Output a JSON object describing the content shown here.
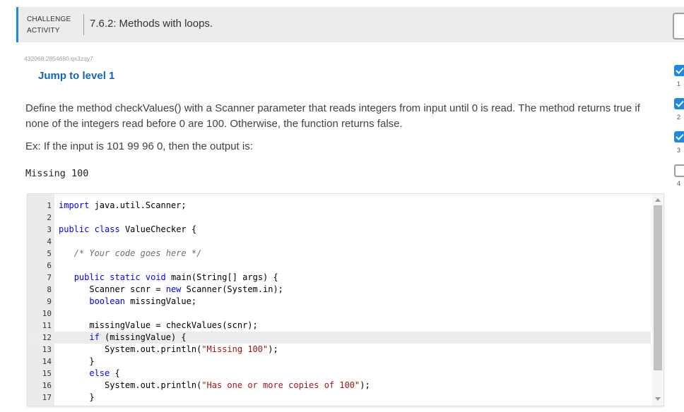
{
  "header": {
    "label_line1": "CHALLENGE",
    "label_line2": "ACTIVITY",
    "title_number": "7.6.2:",
    "title_text": "Methods with loops."
  },
  "activity_code": "432068.2854680.qx3zqy7",
  "jump_link": "Jump to level 1",
  "instructions": {
    "paragraph": "Define the method checkValues() with a Scanner parameter that reads integers from input until 0 is read. The method returns true if none of the integers read before 0 are 100. Otherwise, the function returns false.",
    "example": "Ex: If the input is 101 99 96 0, then the output is:",
    "expected_output": "Missing 100"
  },
  "editor": {
    "active_line": 12,
    "lines": [
      {
        "n": "1",
        "text": "import java.util.Scanner;"
      },
      {
        "n": "2",
        "text": ""
      },
      {
        "n": "3",
        "text": "public class ValueChecker {"
      },
      {
        "n": "4",
        "text": ""
      },
      {
        "n": "5",
        "text": "   /* Your code goes here */"
      },
      {
        "n": "6",
        "text": ""
      },
      {
        "n": "7",
        "text": "   public static void main(String[] args) {"
      },
      {
        "n": "8",
        "text": "      Scanner scnr = new Scanner(System.in);"
      },
      {
        "n": "9",
        "text": "      boolean missingValue;"
      },
      {
        "n": "10",
        "text": ""
      },
      {
        "n": "11",
        "text": "      missingValue = checkValues(scnr);"
      },
      {
        "n": "12",
        "text": "      if (missingValue) {"
      },
      {
        "n": "13",
        "text": "         System.out.println(\"Missing 100\");"
      },
      {
        "n": "14",
        "text": "      }"
      },
      {
        "n": "15",
        "text": "      else {"
      },
      {
        "n": "16",
        "text": "         System.out.println(\"Has one or more copies of 100\");"
      },
      {
        "n": "17",
        "text": "      }"
      }
    ]
  },
  "levels": [
    {
      "num": "1",
      "status": "done"
    },
    {
      "num": "2",
      "status": "done"
    },
    {
      "num": "3",
      "status": "done"
    },
    {
      "num": "4",
      "status": "open"
    }
  ],
  "colors": {
    "accent": "#1e88e5",
    "link": "#1565c0",
    "keyword": "#0000ff",
    "string": "#a31515"
  }
}
